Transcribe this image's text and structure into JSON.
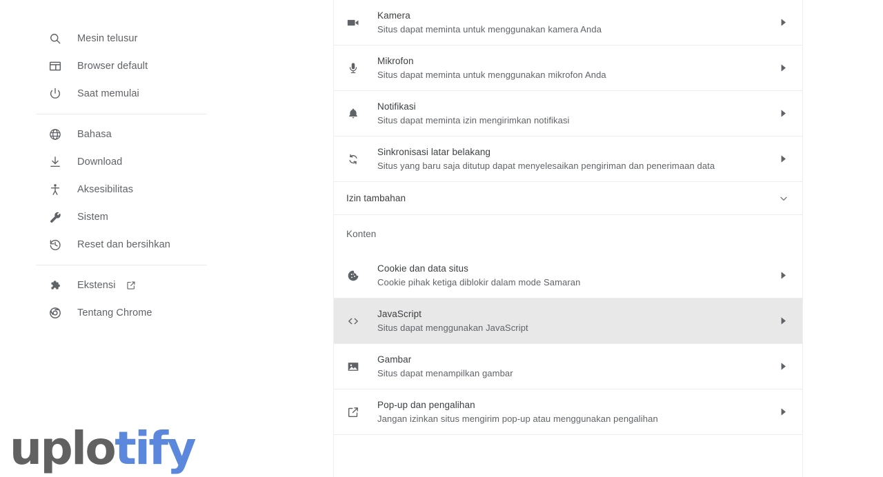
{
  "sidebar": {
    "groups": [
      {
        "items": [
          {
            "label": "Mesin telusur",
            "icon": "search-icon",
            "name": "sidebar-item-search-engine"
          },
          {
            "label": "Browser default",
            "icon": "browser-window-icon",
            "name": "sidebar-item-default-browser"
          },
          {
            "label": "Saat memulai",
            "icon": "power-icon",
            "name": "sidebar-item-on-startup"
          }
        ]
      },
      {
        "items": [
          {
            "label": "Bahasa",
            "icon": "globe-icon",
            "name": "sidebar-item-languages"
          },
          {
            "label": "Download",
            "icon": "download-icon",
            "name": "sidebar-item-downloads"
          },
          {
            "label": "Aksesibilitas",
            "icon": "accessibility-icon",
            "name": "sidebar-item-accessibility"
          },
          {
            "label": "Sistem",
            "icon": "wrench-icon",
            "name": "sidebar-item-system"
          },
          {
            "label": "Reset dan bersihkan",
            "icon": "history-restore-icon",
            "name": "sidebar-item-reset-clean"
          }
        ]
      },
      {
        "items": [
          {
            "label": "Ekstensi",
            "icon": "puzzle-icon",
            "name": "sidebar-item-extensions",
            "external": true
          },
          {
            "label": "Tentang Chrome",
            "icon": "chrome-logo-icon",
            "name": "sidebar-item-about-chrome"
          }
        ]
      }
    ]
  },
  "main": {
    "permission_rows": [
      {
        "title": "Kamera",
        "subtitle": "Situs dapat meminta untuk menggunakan kamera Anda",
        "icon": "video-camera-icon",
        "name": "setting-row-camera",
        "hovered": false
      },
      {
        "title": "Mikrofon",
        "subtitle": "Situs dapat meminta untuk menggunakan mikrofon Anda",
        "icon": "microphone-icon",
        "name": "setting-row-microphone",
        "hovered": false
      },
      {
        "title": "Notifikasi",
        "subtitle": "Situs dapat meminta izin mengirimkan notifikasi",
        "icon": "bell-icon",
        "name": "setting-row-notifications",
        "hovered": false
      },
      {
        "title": "Sinkronisasi latar belakang",
        "subtitle": "Situs yang baru saja ditutup dapat menyelesaikan pengiriman dan penerimaan data",
        "icon": "sync-icon",
        "name": "setting-row-background-sync",
        "hovered": false
      }
    ],
    "expandable": {
      "label": "Izin tambahan",
      "chevron": "chevron-down-icon",
      "name": "expandable-additional-permissions"
    },
    "content_section_title": "Konten",
    "content_rows": [
      {
        "title": "Cookie dan data situs",
        "subtitle": "Cookie pihak ketiga diblokir dalam mode Samaran",
        "icon": "cookie-icon",
        "name": "setting-row-cookies",
        "hovered": false
      },
      {
        "title": "JavaScript",
        "subtitle": "Situs dapat menggunakan JavaScript",
        "icon": "code-brackets-icon",
        "name": "setting-row-javascript",
        "hovered": true
      },
      {
        "title": "Gambar",
        "subtitle": "Situs dapat menampilkan gambar",
        "icon": "image-icon",
        "name": "setting-row-images",
        "hovered": false
      },
      {
        "title": "Pop-up dan pengalihan",
        "subtitle": "Jangan izinkan situs mengirim pop-up atau menggunakan pengalihan",
        "icon": "external-link-icon",
        "name": "setting-row-popups-redirects",
        "hovered": false
      }
    ],
    "row_arrow_icon": "arrow-right-icon"
  },
  "watermark": {
    "part1": "uplo",
    "part2": "tify",
    "color1": "#616161",
    "color2": "#5b87dc"
  }
}
